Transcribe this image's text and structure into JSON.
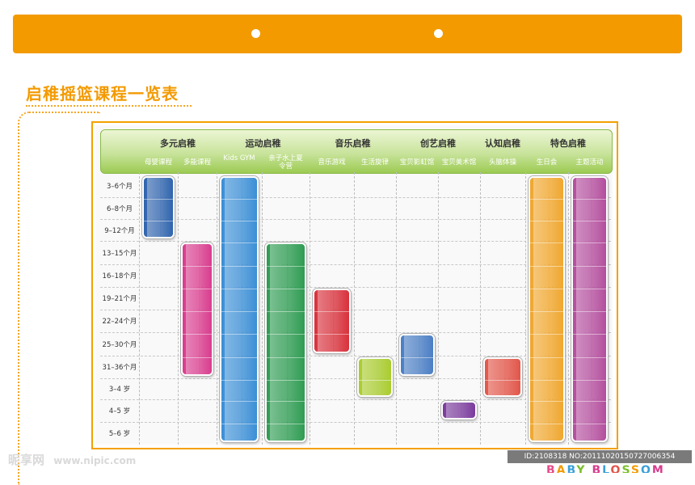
{
  "title": "启稚摇篮课程一览表",
  "categories": [
    {
      "label": "多元启稚",
      "subs": [
        "母婴课程",
        "多能课程"
      ]
    },
    {
      "label": "运动启稚",
      "subs": [
        "Kids GYM",
        "亲子水上夏令营"
      ]
    },
    {
      "label": "音乐启稚",
      "subs": [
        "音乐游戏",
        "生活旋律"
      ]
    },
    {
      "label": "创艺启稚",
      "subs": [
        "宝贝影虹馆",
        "宝贝美术馆"
      ]
    },
    {
      "label": "认知启稚",
      "subs": [
        "头脑体操"
      ]
    },
    {
      "label": "特色启稚",
      "subs": [
        "生日会",
        "主题活动"
      ]
    }
  ],
  "ages": [
    "3–6个月",
    "6–8个月",
    "9–12个月",
    "13–15个月",
    "16–18个月",
    "19–21个月",
    "22–24个月",
    "25–30个月",
    "31–36个月",
    "3–4 岁",
    "4–5 岁",
    "5–6 岁"
  ],
  "courses": [
    {
      "course": "母婴课程",
      "from": "3–6个月",
      "to": "9–12个月",
      "color": "#2f64ad"
    },
    {
      "course": "多能课程",
      "from": "13–15个月",
      "to": "31–36个月",
      "color": "#d93c8e"
    },
    {
      "course": "Kids GYM",
      "from": "3–6个月",
      "to": "5–6 岁",
      "color": "#3b8fd6"
    },
    {
      "course": "亲子水上夏令营",
      "from": "13–15个月",
      "to": "5–6 岁",
      "color": "#2e9c52"
    },
    {
      "course": "音乐游戏",
      "from": "19–21个月",
      "to": "25–30个月",
      "color": "#d8323c"
    },
    {
      "course": "生活旋律",
      "from": "31–36个月",
      "to": "3–4 岁",
      "color": "#a9cc2f"
    },
    {
      "course": "宝贝影虹馆",
      "from": "25–30个月",
      "to": "31–36个月",
      "color": "#4a7ec4"
    },
    {
      "course": "宝贝美术馆",
      "from": "4–5 岁",
      "to": "4–5 岁",
      "color": "#7a3a9c"
    },
    {
      "course": "头脑体操",
      "from": "31–36个月",
      "to": "3–4 岁",
      "color": "#e2564a"
    },
    {
      "course": "生日会",
      "from": "3–6个月",
      "to": "5–6 岁",
      "color": "#f0a72e"
    },
    {
      "course": "主题活动",
      "from": "3–6个月",
      "to": "5–6 岁",
      "color": "#b44e9e"
    }
  ],
  "watermark_left": "昵享网",
  "watermark_url": "www.nipic.com",
  "watermark_right": "ID:2108318 NO:20111020150727006354",
  "brand": "BABY BLOSSOM",
  "colors": {
    "accent": "#f39a00",
    "header_green": "#9ccb52"
  }
}
